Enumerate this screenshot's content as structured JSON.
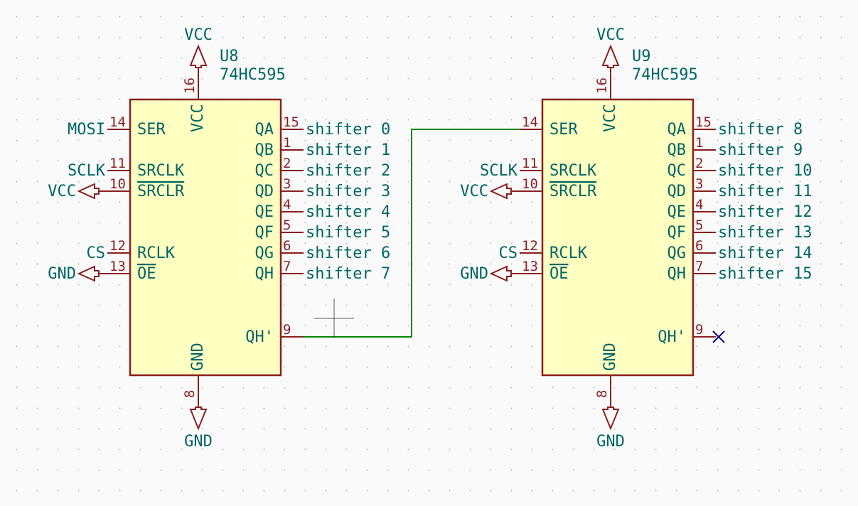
{
  "chips": [
    {
      "ref": "U8",
      "part": "74HC595",
      "power": {
        "top": "VCC",
        "bottom": "GND",
        "top_pin": "16",
        "bottom_pin": "8"
      },
      "left": [
        {
          "num": "14",
          "name": "SER",
          "net": "MOSI",
          "type": "netlabel"
        },
        {
          "num": "11",
          "name": "SRCLK",
          "net": "SCLK",
          "type": "netlabel"
        },
        {
          "num": "10",
          "name": "SRCLR",
          "net": "VCC",
          "type": "arrow",
          "bar": true
        },
        {
          "num": "12",
          "name": "RCLK",
          "net": "CS",
          "type": "netlabel"
        },
        {
          "num": "13",
          "name": "OE",
          "net": "GND",
          "type": "arrow",
          "bar": true
        }
      ],
      "right": [
        {
          "num": "15",
          "name": "QA",
          "net": "shifter 0"
        },
        {
          "num": "1",
          "name": "QB",
          "net": "shifter 1"
        },
        {
          "num": "2",
          "name": "QC",
          "net": "shifter 2"
        },
        {
          "num": "3",
          "name": "QD",
          "net": "shifter 3"
        },
        {
          "num": "4",
          "name": "QE",
          "net": "shifter 4"
        },
        {
          "num": "5",
          "name": "QF",
          "net": "shifter 5"
        },
        {
          "num": "6",
          "name": "QG",
          "net": "shifter 6"
        },
        {
          "num": "7",
          "name": "QH",
          "net": "shifter 7"
        }
      ],
      "cascade": {
        "num": "9",
        "name": "QH'"
      }
    },
    {
      "ref": "U9",
      "part": "74HC595",
      "power": {
        "top": "VCC",
        "bottom": "GND",
        "top_pin": "16",
        "bottom_pin": "8"
      },
      "left": [
        {
          "num": "14",
          "name": "SER",
          "net": "",
          "type": "wire"
        },
        {
          "num": "11",
          "name": "SRCLK",
          "net": "SCLK",
          "type": "netlabel"
        },
        {
          "num": "10",
          "name": "SRCLR",
          "net": "VCC",
          "type": "arrow",
          "bar": true
        },
        {
          "num": "12",
          "name": "RCLK",
          "net": "CS",
          "type": "netlabel"
        },
        {
          "num": "13",
          "name": "OE",
          "net": "GND",
          "type": "arrow",
          "bar": true
        }
      ],
      "right": [
        {
          "num": "15",
          "name": "QA",
          "net": "shifter 8"
        },
        {
          "num": "1",
          "name": "QB",
          "net": "shifter 9"
        },
        {
          "num": "2",
          "name": "QC",
          "net": "shifter 10"
        },
        {
          "num": "3",
          "name": "QD",
          "net": "shifter 11"
        },
        {
          "num": "4",
          "name": "QE",
          "net": "shifter 12"
        },
        {
          "num": "5",
          "name": "QF",
          "net": "shifter 13"
        },
        {
          "num": "6",
          "name": "QG",
          "net": "shifter 14"
        },
        {
          "num": "7",
          "name": "QH",
          "net": "shifter 15"
        }
      ],
      "cascade": {
        "num": "9",
        "name": "QH'",
        "noconn": true
      }
    }
  ]
}
